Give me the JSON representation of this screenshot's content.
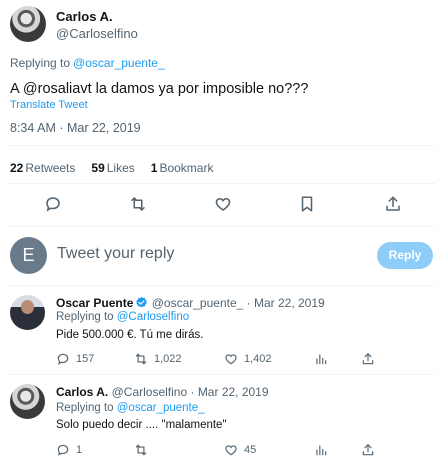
{
  "main_tweet": {
    "author_name": "Carlos A.",
    "author_handle": "@Carloselfino",
    "replying_prefix": "Replying to",
    "replying_to": "@oscar_puente_",
    "text": "A @rosaliavt  la damos ya por imposible no???",
    "translate_label": "Translate Tweet",
    "timestamp": "8:34 AM · Mar 22, 2019",
    "stats": {
      "retweets_count": "22",
      "retweets_label": "Retweets",
      "likes_count": "59",
      "likes_label": "Likes",
      "bookmarks_count": "1",
      "bookmarks_label": "Bookmark"
    },
    "actions": [
      "reply-icon",
      "retweet-icon",
      "like-icon",
      "bookmark-icon",
      "share-icon"
    ]
  },
  "composer": {
    "avatar_letter": "E",
    "placeholder": "Tweet your reply",
    "button_label": "Reply"
  },
  "replies": [
    {
      "name": "Oscar Puente",
      "verified": true,
      "handle": "@oscar_puente_",
      "date": "· Mar 22, 2019",
      "replying_prefix": "Replying to",
      "replying_to": "@Carloselfino",
      "text": "Pide 500.000 €. Tú me dirás.",
      "replies": "157",
      "retweets": "1,022",
      "likes": "1,402"
    },
    {
      "name": "Carlos A.",
      "verified": false,
      "handle": "@Carloselfino",
      "date": "· Mar 22, 2019",
      "replying_prefix": "Replying to",
      "replying_to": "@oscar_puente_",
      "text": "Solo puedo decir .... \"malamente\"",
      "replies": "1",
      "retweets": "",
      "likes": "45"
    }
  ],
  "colors": {
    "accent": "#1d9bf0",
    "secondary_text": "#536471",
    "reply_button_disabled": "#8ecdf7",
    "divider": "#eff3f4"
  }
}
